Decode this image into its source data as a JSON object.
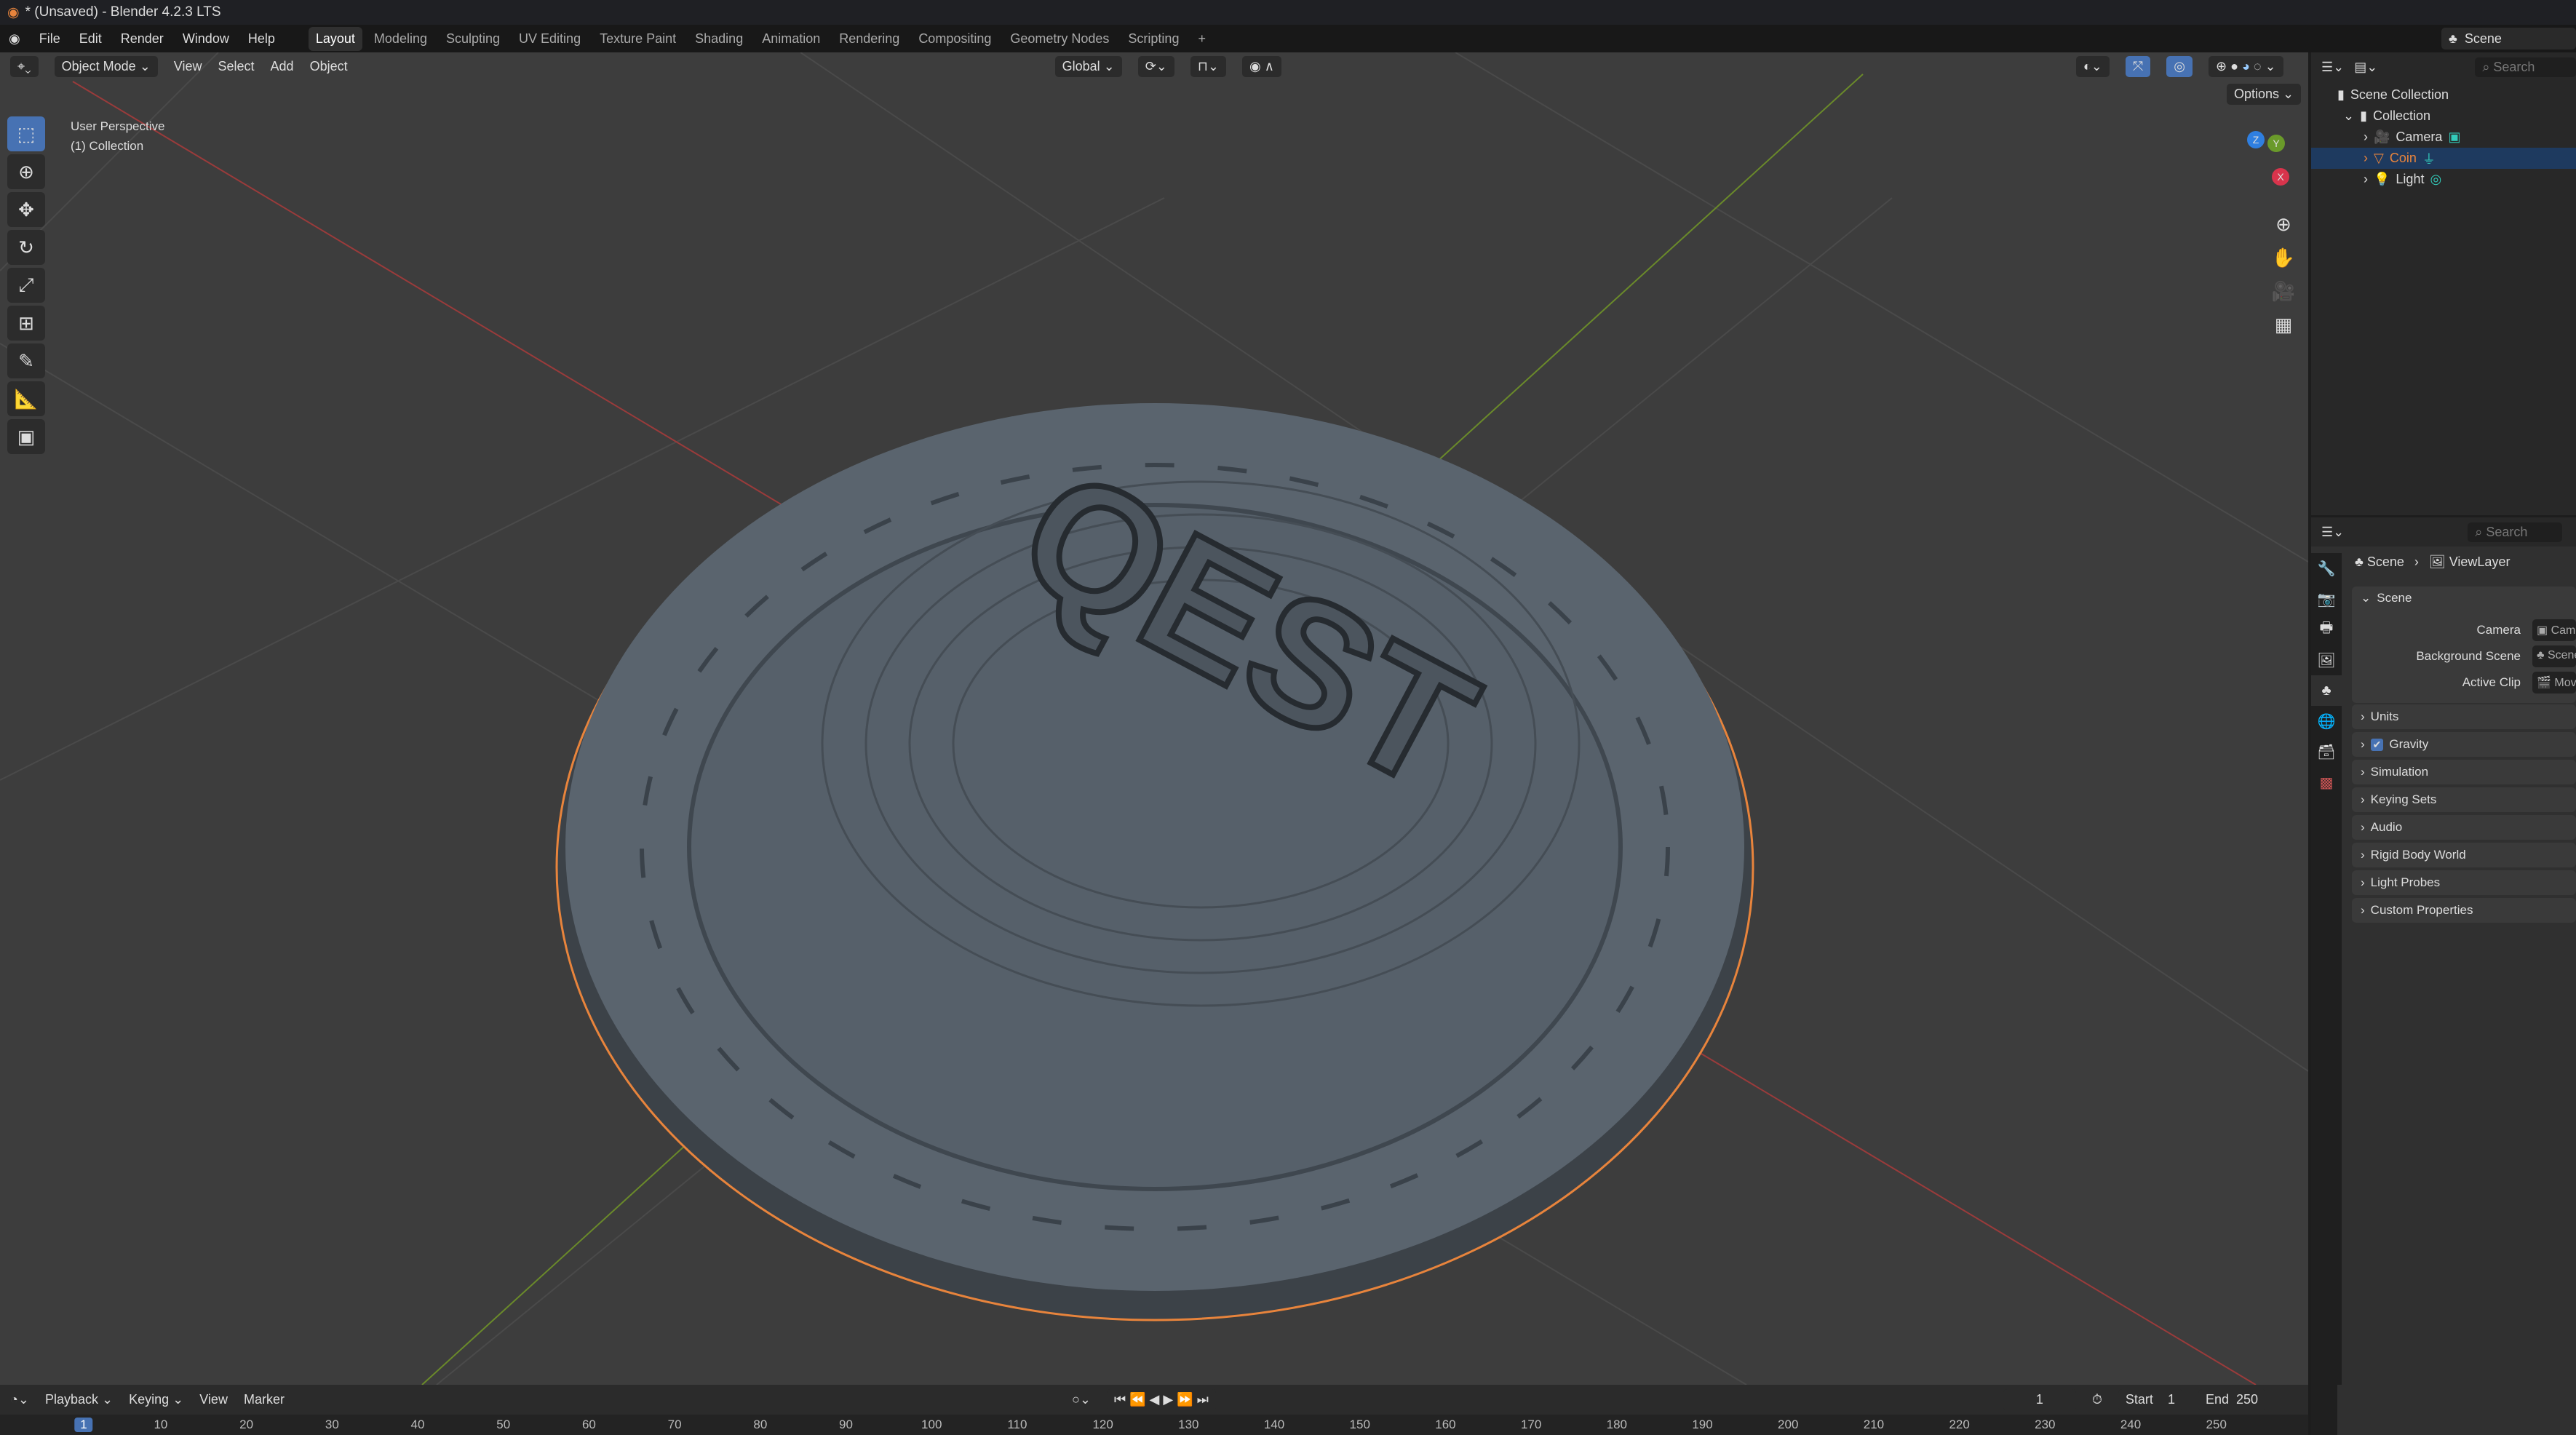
{
  "window": {
    "title": "* (Unsaved) - Blender 4.2.3 LTS"
  },
  "menu": [
    "File",
    "Edit",
    "Render",
    "Window",
    "Help"
  ],
  "workspaces": [
    "Layout",
    "Modeling",
    "Sculpting",
    "UV Editing",
    "Texture Paint",
    "Shading",
    "Animation",
    "Rendering",
    "Compositing",
    "Geometry Nodes",
    "Scripting",
    "+"
  ],
  "scene_selector": "Scene",
  "viewport": {
    "mode": "Object Mode",
    "menus": [
      "View",
      "Select",
      "Add",
      "Object"
    ],
    "orientation": "Global",
    "options": "Options",
    "perspective": "User Perspective",
    "collection": "(1) Collection",
    "coin_text": "QEST",
    "gizmo": {
      "x": "X",
      "y": "Y",
      "z": "Z"
    }
  },
  "outliner": {
    "search_placeholder": "Search",
    "scene_collection": "Scene Collection",
    "collection": "Collection",
    "items": [
      {
        "name": "Camera",
        "color": "#d8d8d8"
      },
      {
        "name": "Coin",
        "color": "#e8843c"
      },
      {
        "name": "Light",
        "color": "#d8d8d8"
      }
    ]
  },
  "properties": {
    "search_placeholder": "Search",
    "breadcrumb": [
      "Scene",
      "ViewLayer"
    ],
    "section": "Scene",
    "fields": [
      {
        "label": "Camera",
        "value": "Camera"
      },
      {
        "label": "Background Scene",
        "value": "Scene"
      },
      {
        "label": "Active Clip",
        "value": "Movie Clip"
      }
    ],
    "panels": [
      "Units",
      "Gravity",
      "Simulation",
      "Keying Sets",
      "Audio",
      "Rigid Body World",
      "Light Probes",
      "Custom Properties"
    ],
    "gravity_checked": true
  },
  "timeline": {
    "menus": [
      "Playback",
      "Keying",
      "View",
      "Marker"
    ],
    "current_frame": "1",
    "start_label": "Start",
    "start": "1",
    "end_label": "End",
    "end": "250",
    "ticks": [
      "1",
      "10",
      "20",
      "30",
      "40",
      "50",
      "60",
      "70",
      "80",
      "90",
      "100",
      "110",
      "120",
      "130",
      "140",
      "150",
      "160",
      "170",
      "180",
      "190",
      "200",
      "210",
      "220",
      "230",
      "240",
      "250"
    ]
  },
  "colors": {
    "accent": "#4772b3",
    "selection": "#e8843c"
  }
}
